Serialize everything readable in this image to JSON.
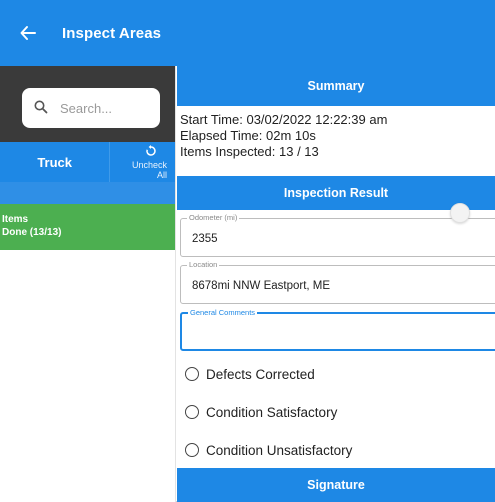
{
  "appbar": {
    "title": "Inspect Areas",
    "back_icon": "arrow-left-icon"
  },
  "colors": {
    "primary": "#1e88e5",
    "success": "#4caf50",
    "dark": "#3a3a3a"
  },
  "sidebar": {
    "search_placeholder": "Search...",
    "tab_truck": "Truck",
    "uncheck_line1": "Uncheck",
    "uncheck_line2": "All",
    "items_title": "Items",
    "items_done": "Done (13/13)"
  },
  "summary": {
    "heading": "Summary",
    "start_time": "Start Time: 03/02/2022 12:22:39 am",
    "elapsed_time": "Elapsed Time: 02m 10s",
    "items_inspected": "Items Inspected: 13 / 13"
  },
  "inspection": {
    "heading": "Inspection Result",
    "odometer_label": "Odometer (mi)",
    "odometer_value": "2355",
    "location_label": "Location",
    "location_value": "8678mi NNW Eastport, ME",
    "comments_label": "General Comments",
    "comments_value": "",
    "options": [
      "Defects Corrected",
      "Condition Satisfactory",
      "Condition Unsatisfactory"
    ]
  },
  "signature": {
    "heading": "Signature"
  }
}
